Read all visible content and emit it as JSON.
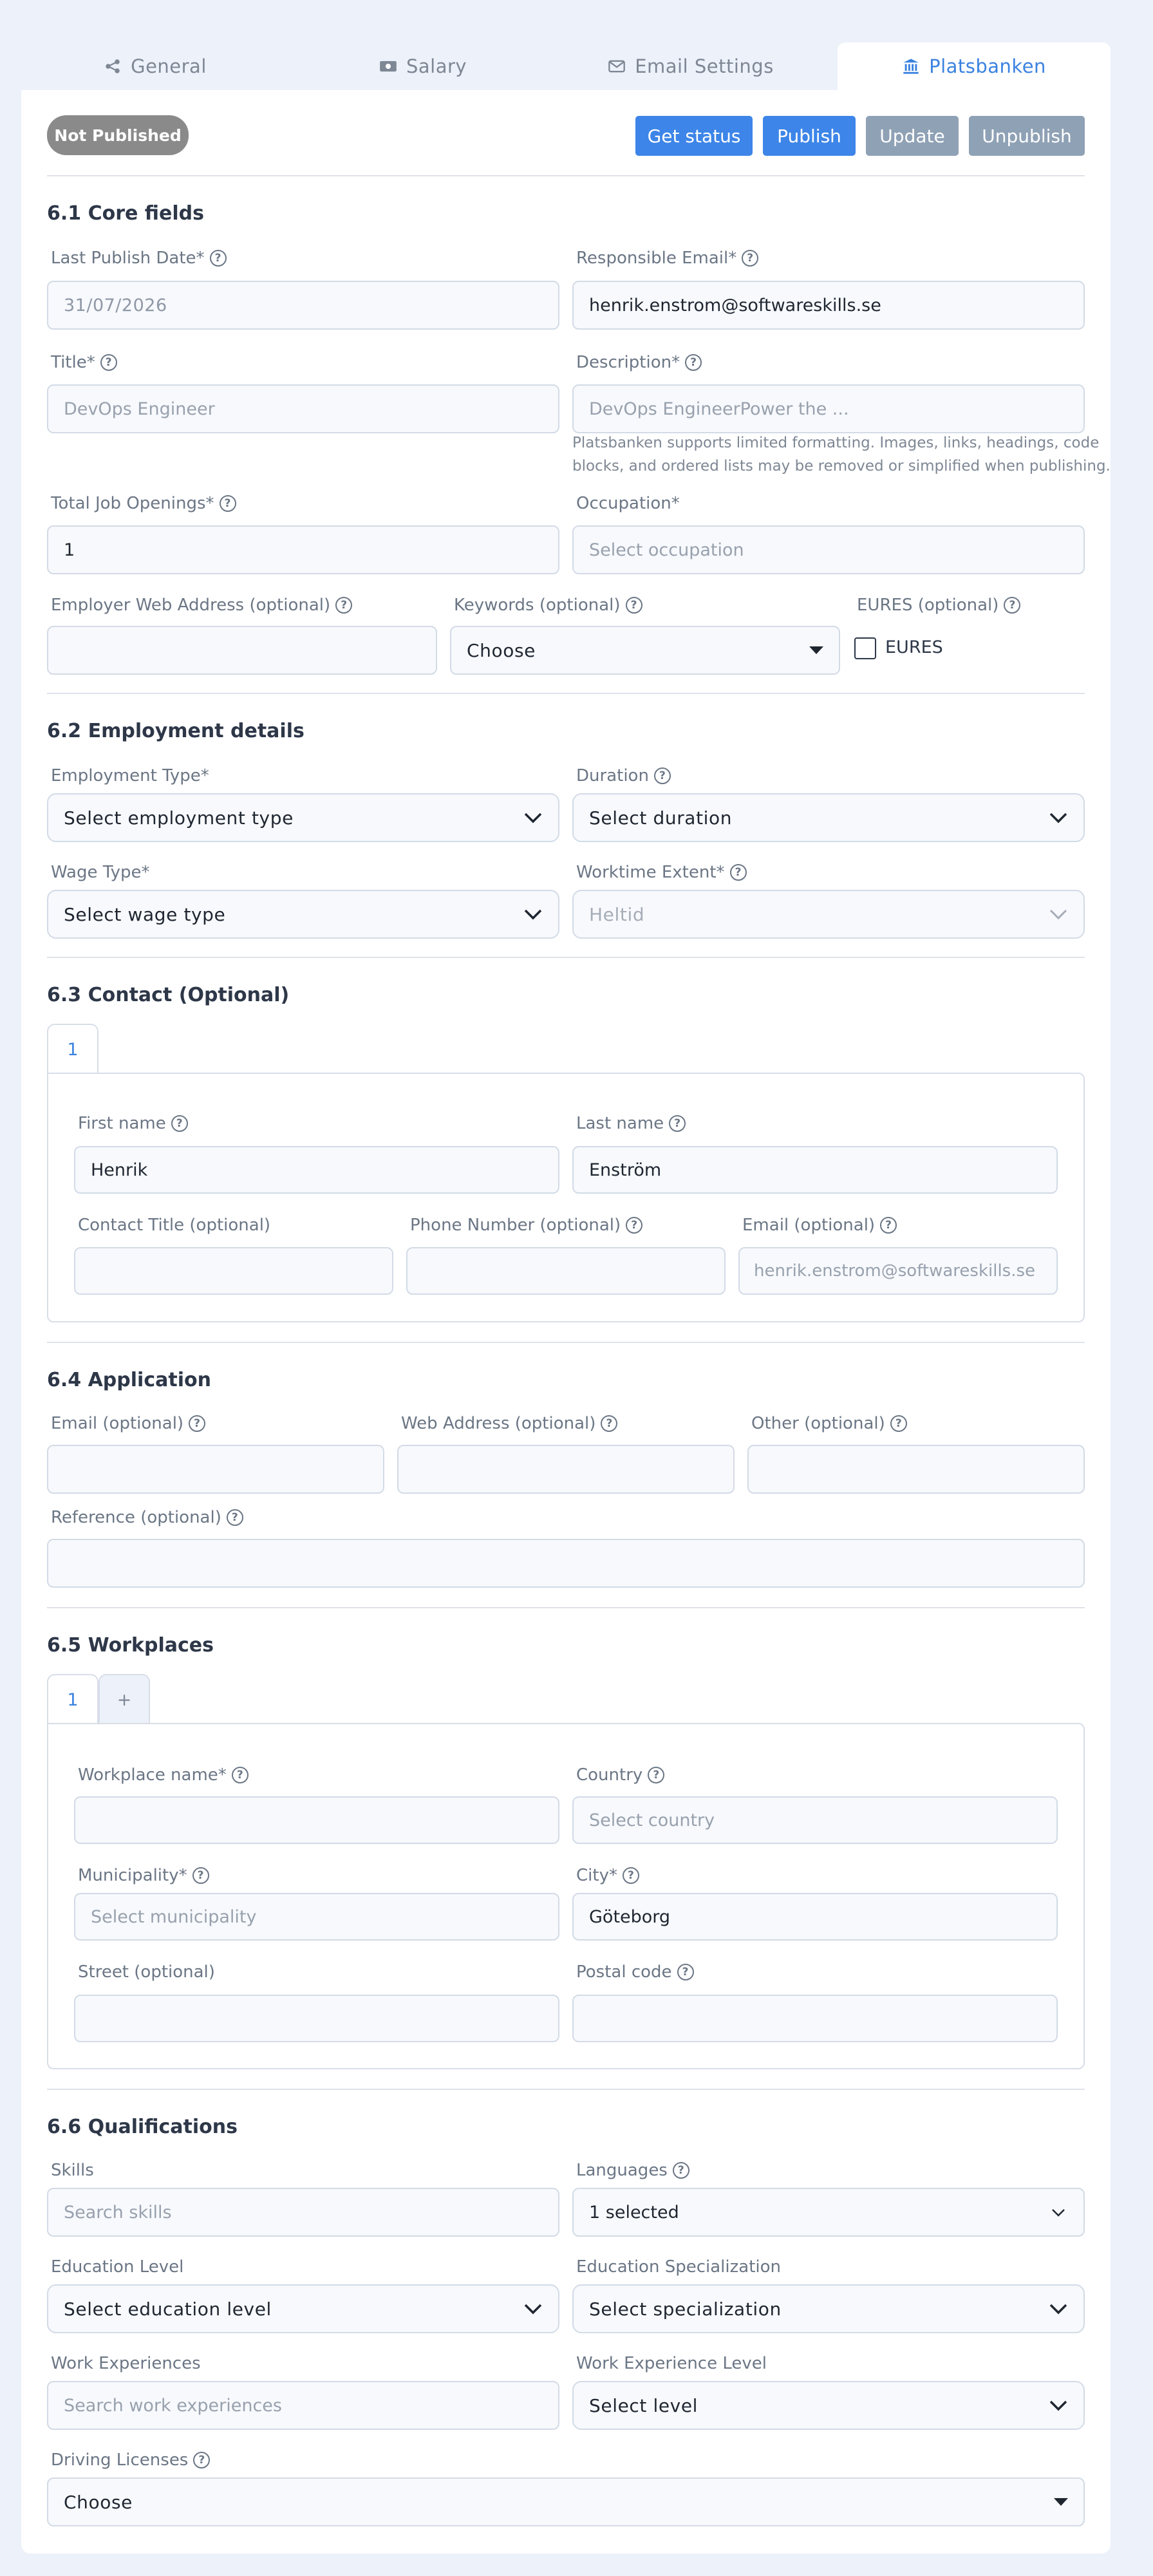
{
  "tabs": [
    {
      "label": "General",
      "icon": "share-icon"
    },
    {
      "label": "Salary",
      "icon": "money-icon"
    },
    {
      "label": "Email Settings",
      "icon": "envelope-icon"
    },
    {
      "label": "Platsbanken",
      "icon": "bank-icon"
    }
  ],
  "status_badge": "Not Published",
  "actions": {
    "get_status": "Get status",
    "publish": "Publish",
    "update": "Update",
    "unpublish": "Unpublish"
  },
  "core": {
    "heading": "6.1 Core fields",
    "last_publish_label": "Last Publish Date*",
    "last_publish_value": "31/07/2026",
    "resp_email_label": "Responsible Email*",
    "resp_email_value": "henrik.enstrom@softwareskills.se",
    "title_label": "Title*",
    "title_value": "DevOps Engineer",
    "desc_label": "Description*",
    "desc_value": "DevOps EngineerPower the ...",
    "desc_hint_1": "Platsbanken supports limited formatting. Images, links, headings, code",
    "desc_hint_2": "blocks, and ordered lists may be removed or simplified when publishing.",
    "openings_label": "Total Job Openings*",
    "openings_value": "1",
    "occupation_label": "Occupation*",
    "occupation_placeholder": "Select occupation",
    "web_label": "Employer Web Address (optional)",
    "web_value": "",
    "keywords_label": "Keywords (optional)",
    "keywords_value": "Choose",
    "eures_label": "EURES (optional)",
    "eures_checkbox": "EURES"
  },
  "employment": {
    "heading": "6.2 Employment details",
    "type_label": "Employment Type*",
    "type_value": "Select employment type",
    "duration_label": "Duration",
    "duration_value": "Select duration",
    "wage_label": "Wage Type*",
    "wage_value": "Select wage type",
    "worktime_label": "Worktime Extent*",
    "worktime_value": "Heltid"
  },
  "contact": {
    "heading": "6.3 Contact (Optional)",
    "tab": "1",
    "first_label": "First name",
    "first_value": "Henrik",
    "last_label": "Last name",
    "last_value": "Enström",
    "title_label": "Contact Title (optional)",
    "title_value": "",
    "phone_label": "Phone Number (optional)",
    "phone_value": "",
    "email_label": "Email (optional)",
    "email_placeholder": "henrik.enstrom@softwareskills.se"
  },
  "application": {
    "heading": "6.4 Application",
    "email_label": "Email (optional)",
    "web_label": "Web Address (optional)",
    "other_label": "Other (optional)",
    "reference_label": "Reference (optional)"
  },
  "workplaces": {
    "heading": "6.5 Workplaces",
    "tab": "1",
    "add_tab": "+",
    "name_label": "Workplace name*",
    "name_value": "",
    "country_label": "Country",
    "country_placeholder": "Select country",
    "municipality_label": "Municipality*",
    "municipality_placeholder": "Select municipality",
    "city_label": "City*",
    "city_value": "Göteborg",
    "street_label": "Street (optional)",
    "postal_label": "Postal code"
  },
  "qualifications": {
    "heading": "6.6 Qualifications",
    "skills_label": "Skills",
    "skills_placeholder": "Search skills",
    "languages_label": "Languages",
    "languages_value": "1 selected",
    "edu_level_label": "Education Level",
    "edu_level_value": "Select education level",
    "edu_spec_label": "Education Specialization",
    "edu_spec_value": "Select specialization",
    "work_exp_label": "Work Experiences",
    "work_exp_placeholder": "Search work experiences",
    "work_level_label": "Work Experience Level",
    "work_level_value": "Select level",
    "driving_label": "Driving Licenses",
    "driving_value": "Choose"
  },
  "colors": {
    "accent": "#3d85e8",
    "badge": "#8a8a8a",
    "disabled_button": "#8fa1b5",
    "background": "#edf1fa"
  }
}
